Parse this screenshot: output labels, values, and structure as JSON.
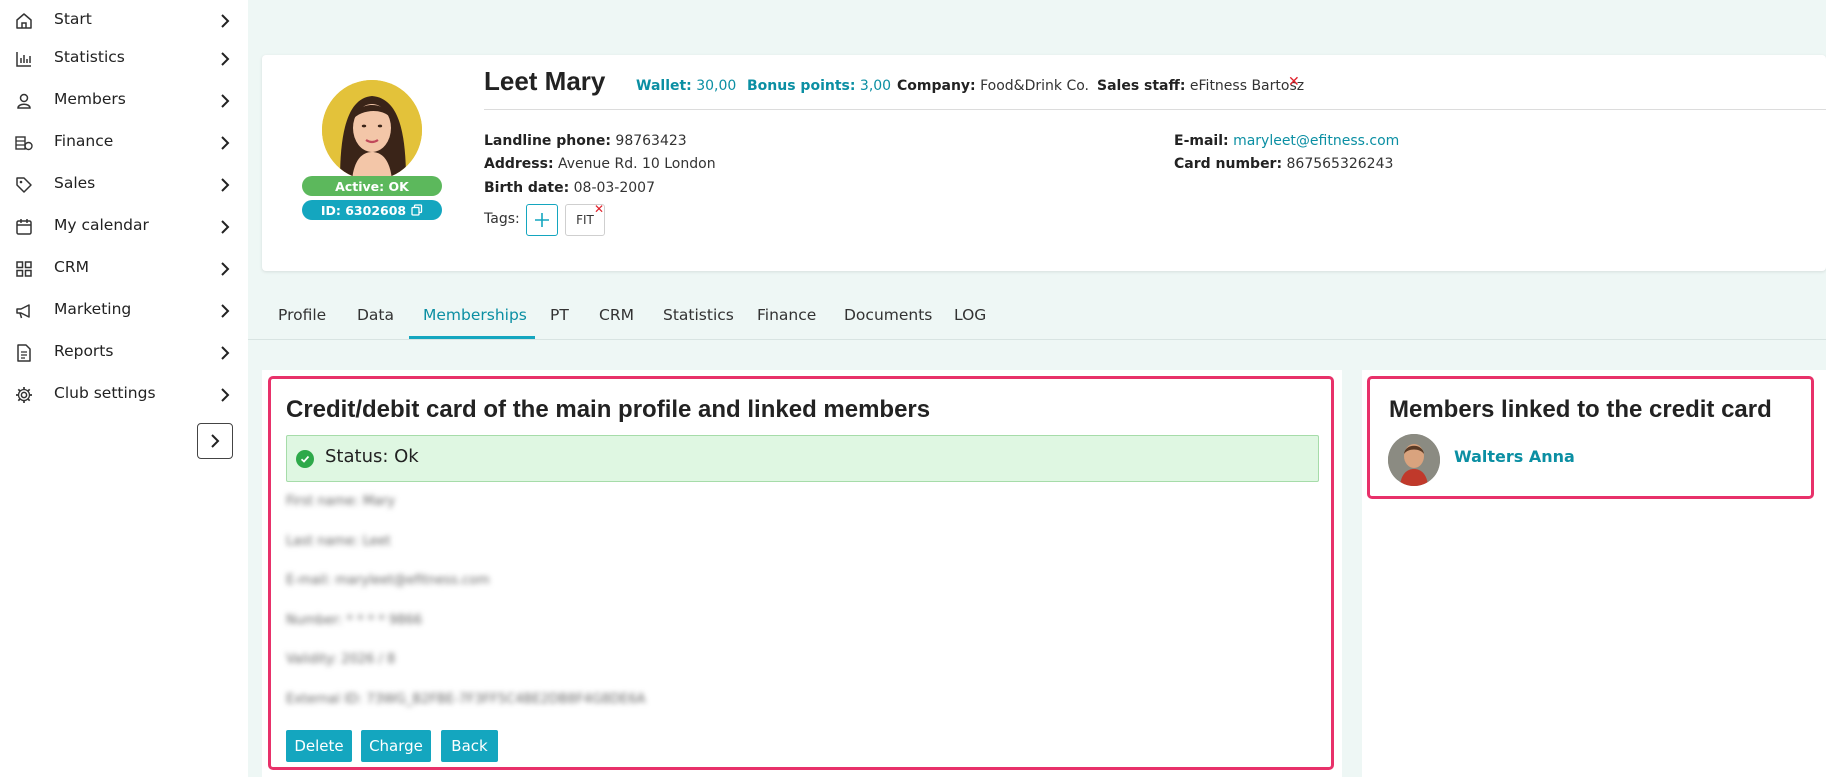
{
  "sidebar": {
    "items": [
      {
        "label": "Start",
        "icon": "home-icon"
      },
      {
        "label": "Statistics",
        "icon": "bar-chart-icon"
      },
      {
        "label": "Members",
        "icon": "user-icon"
      },
      {
        "label": "Finance",
        "icon": "coins-icon"
      },
      {
        "label": "Sales",
        "icon": "tag-icon"
      },
      {
        "label": "My calendar",
        "icon": "calendar-icon"
      },
      {
        "label": "CRM",
        "icon": "grid-icon"
      },
      {
        "label": "Marketing",
        "icon": "megaphone-icon"
      },
      {
        "label": "Reports",
        "icon": "document-icon"
      },
      {
        "label": "Club settings",
        "icon": "gear-icon"
      }
    ],
    "collapse_icon": "chevron-right-icon"
  },
  "member": {
    "name": "Leet Mary",
    "active_badge": "Active: OK",
    "id_badge": "ID: 6302608",
    "wallet_label": "Wallet:",
    "wallet_value": "30,00",
    "bonus_label": "Bonus points:",
    "bonus_value": "3,00",
    "company_label": "Company:",
    "company_value": "Food&Drink Co.",
    "sales_staff_label": "Sales staff:",
    "sales_staff_value": "eFitness Bartosz",
    "landline_label": "Landline phone:",
    "landline_value": "98763423",
    "address_label": "Address:",
    "address_value": "Avenue Rd. 10 London",
    "birth_label": "Birth date:",
    "birth_value": "08-03-2007",
    "email_label": "E-mail:",
    "email_value": "maryleet@efitness.com",
    "card_number_label": "Card number:",
    "card_number_value": "867565326243",
    "tags_label": "Tags:",
    "tags": [
      "FIT"
    ]
  },
  "tabs": [
    {
      "label": "Profile",
      "active": false
    },
    {
      "label": "Data",
      "active": false
    },
    {
      "label": "Memberships",
      "active": true
    },
    {
      "label": "PT",
      "active": false
    },
    {
      "label": "CRM",
      "active": false
    },
    {
      "label": "Statistics",
      "active": false
    },
    {
      "label": "Finance",
      "active": false
    },
    {
      "label": "Documents",
      "active": false
    },
    {
      "label": "LOG",
      "active": false
    }
  ],
  "card_panel": {
    "title": "Credit/debit card of the main profile and linked members",
    "status": "Status: Ok",
    "blurred_lines": [
      "First name: Mary",
      "Last name: Leet",
      "E-mail: maryleet@efitness.com",
      "Number: * * * * 9866",
      "Validity: 2026 / 8",
      "External ID: 73WG_B2FBE-7F3FF5C4BE2DB8F4G8DE6A"
    ],
    "buttons": {
      "delete": "Delete",
      "charge": "Charge",
      "back": "Back"
    }
  },
  "linked_panel": {
    "title": "Members linked to the credit card",
    "members": [
      {
        "name": "Walters Anna"
      }
    ]
  },
  "colors": {
    "accent": "#14a6bf",
    "accent_text": "#0b8fa3",
    "active_green": "#5cb85c",
    "highlight": "#e8316a",
    "status_bg": "#dff7e2",
    "remove_red": "#e0202a",
    "page_bg": "#eef7f5"
  }
}
